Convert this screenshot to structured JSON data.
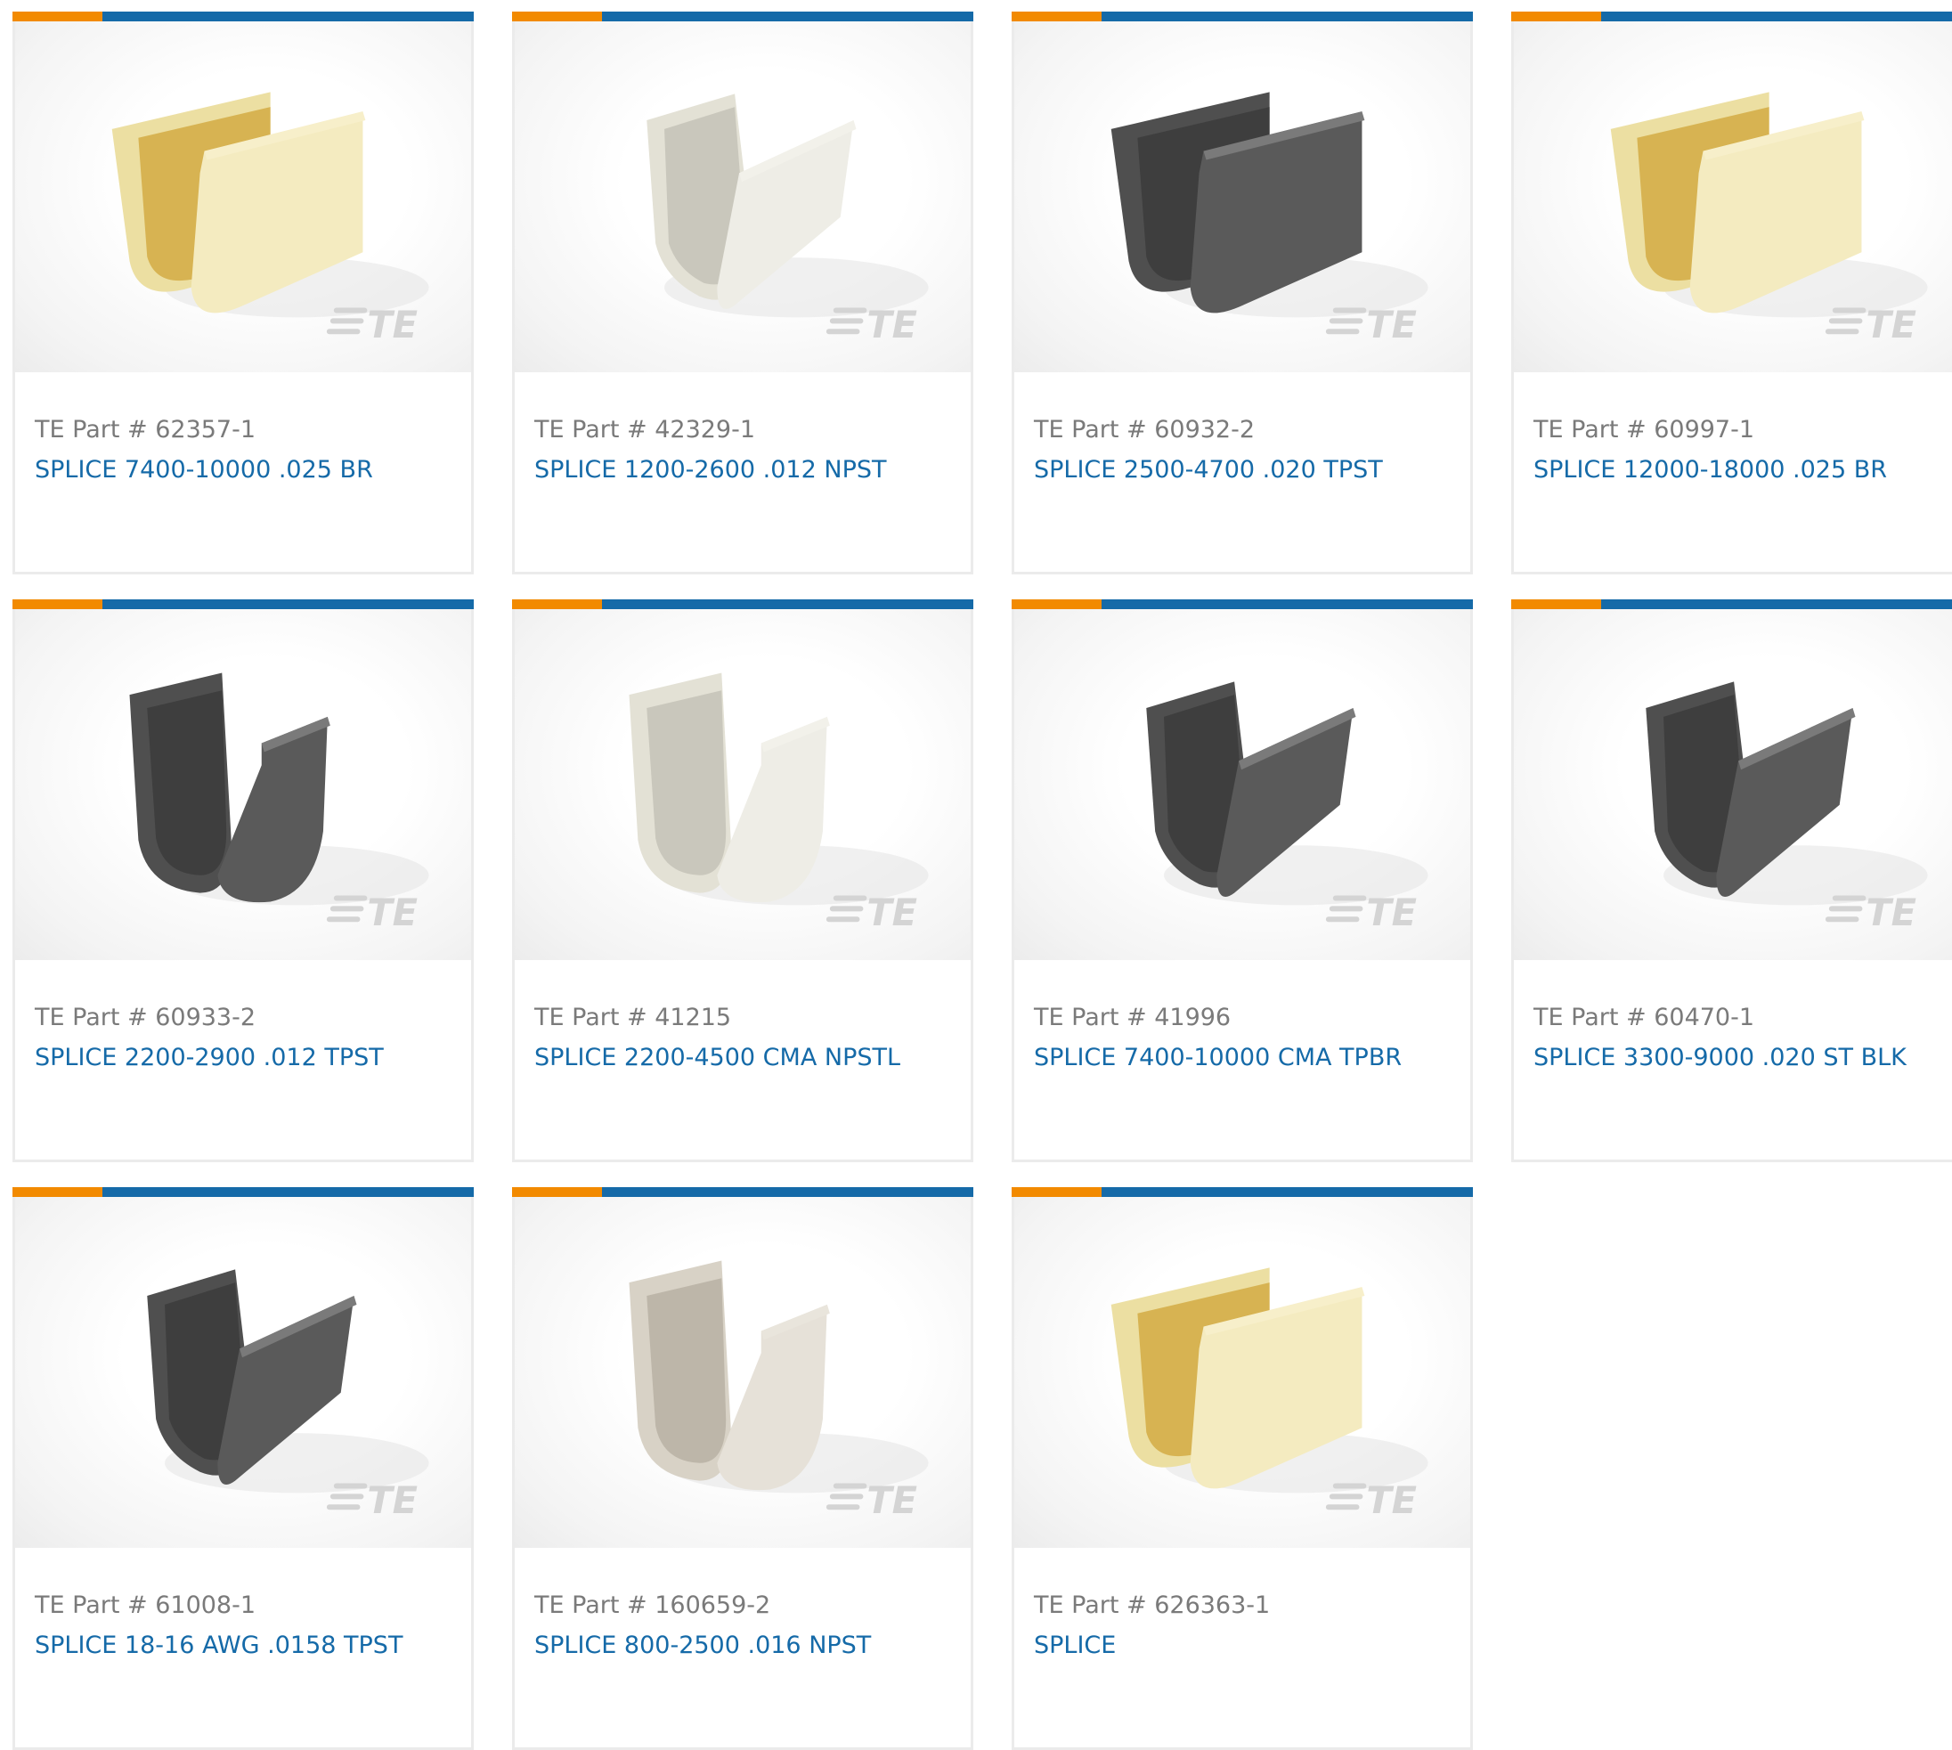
{
  "colors": {
    "accent_orange": "#f28a00",
    "accent_blue": "#156aa8",
    "part_gray": "#7a7a7a"
  },
  "watermark_text": "TE",
  "products": [
    {
      "part": "TE Part # 62357-1",
      "name": "SPLICE 7400-10000 .025 BR",
      "finish": "brass",
      "shape": "u-wide"
    },
    {
      "part": "TE Part # 42329-1",
      "name": "SPLICE 1200-2600 .012 NPST",
      "finish": "silver",
      "shape": "v"
    },
    {
      "part": "TE Part # 60932-2",
      "name": "SPLICE 2500-4700 .020 TPST",
      "finish": "dark",
      "shape": "u-wide"
    },
    {
      "part": "TE Part # 60997-1",
      "name": "SPLICE 12000-18000 .025 BR",
      "finish": "brass",
      "shape": "u-wide"
    },
    {
      "part": "TE Part # 60933-2",
      "name": "SPLICE 2200-2900 .012 TPST",
      "finish": "dark",
      "shape": "u"
    },
    {
      "part": "TE Part # 41215",
      "name": "SPLICE 2200-4500 CMA NPSTL",
      "finish": "silver",
      "shape": "u"
    },
    {
      "part": "TE Part # 41996",
      "name": "SPLICE 7400-10000 CMA TPBR",
      "finish": "dark",
      "shape": "v"
    },
    {
      "part": "TE Part # 60470-1",
      "name": "SPLICE 3300-9000 .020 ST BLK",
      "finish": "dark",
      "shape": "v"
    },
    {
      "part": "TE Part # 61008-1",
      "name": "SPLICE 18-16 AWG .0158 TPST",
      "finish": "dark",
      "shape": "v"
    },
    {
      "part": "TE Part # 160659-2",
      "name": "SPLICE 800-2500 .016 NPST",
      "finish": "tin",
      "shape": "u"
    },
    {
      "part": "TE Part # 626363-1",
      "name": "SPLICE",
      "finish": "brass",
      "shape": "u-wide"
    }
  ]
}
